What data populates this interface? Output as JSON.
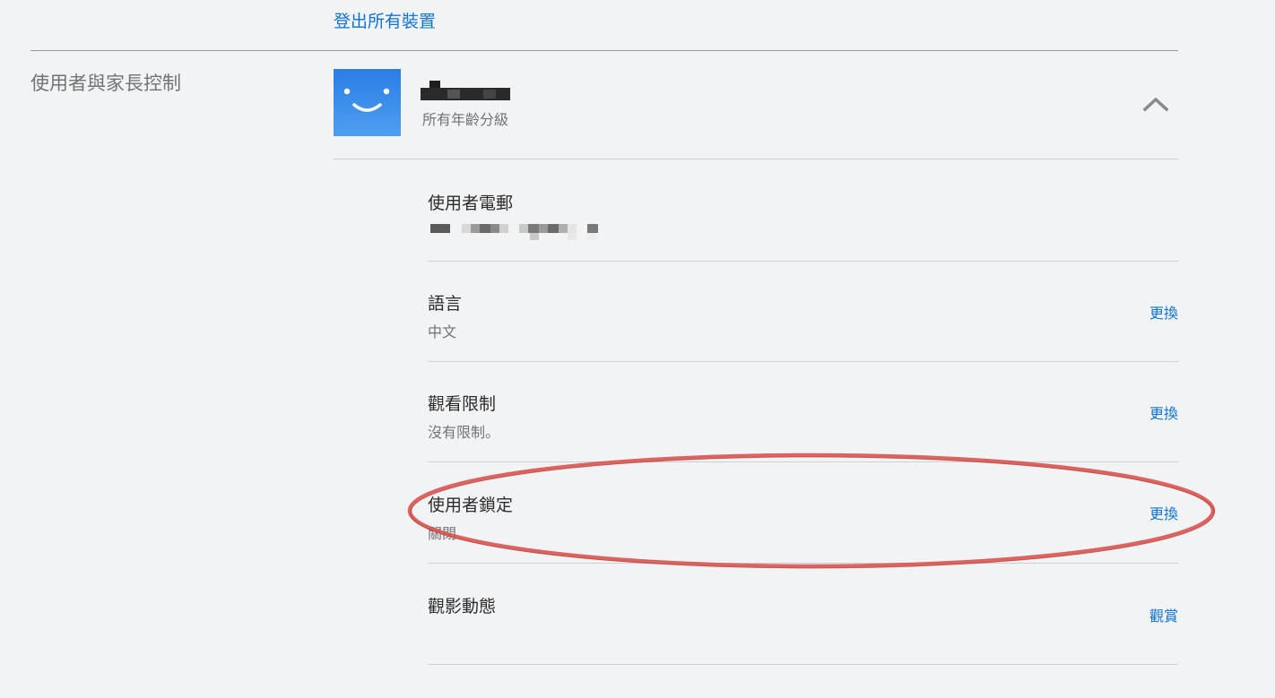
{
  "signout_all_devices": "登出所有裝置",
  "section_title": "使用者與家長控制",
  "profile": {
    "avatar_icon": "smiley-face-icon",
    "avatar_color": "#2a7ee5",
    "maturity_label": "所有年齡分級",
    "collapse_icon": "chevron-up-icon"
  },
  "rows": [
    {
      "label": "使用者電郵",
      "value": "",
      "action": ""
    },
    {
      "label": "語言",
      "value": "中文",
      "action": "更換"
    },
    {
      "label": "觀看限制",
      "value": "沒有限制。",
      "action": "更換"
    },
    {
      "label": "使用者鎖定",
      "value": "關閉",
      "action": "更換"
    },
    {
      "label": "觀影動態",
      "value": "",
      "action": "觀賞"
    }
  ],
  "colors": {
    "link": "#0f74d4",
    "annotation": "#d9534f"
  }
}
